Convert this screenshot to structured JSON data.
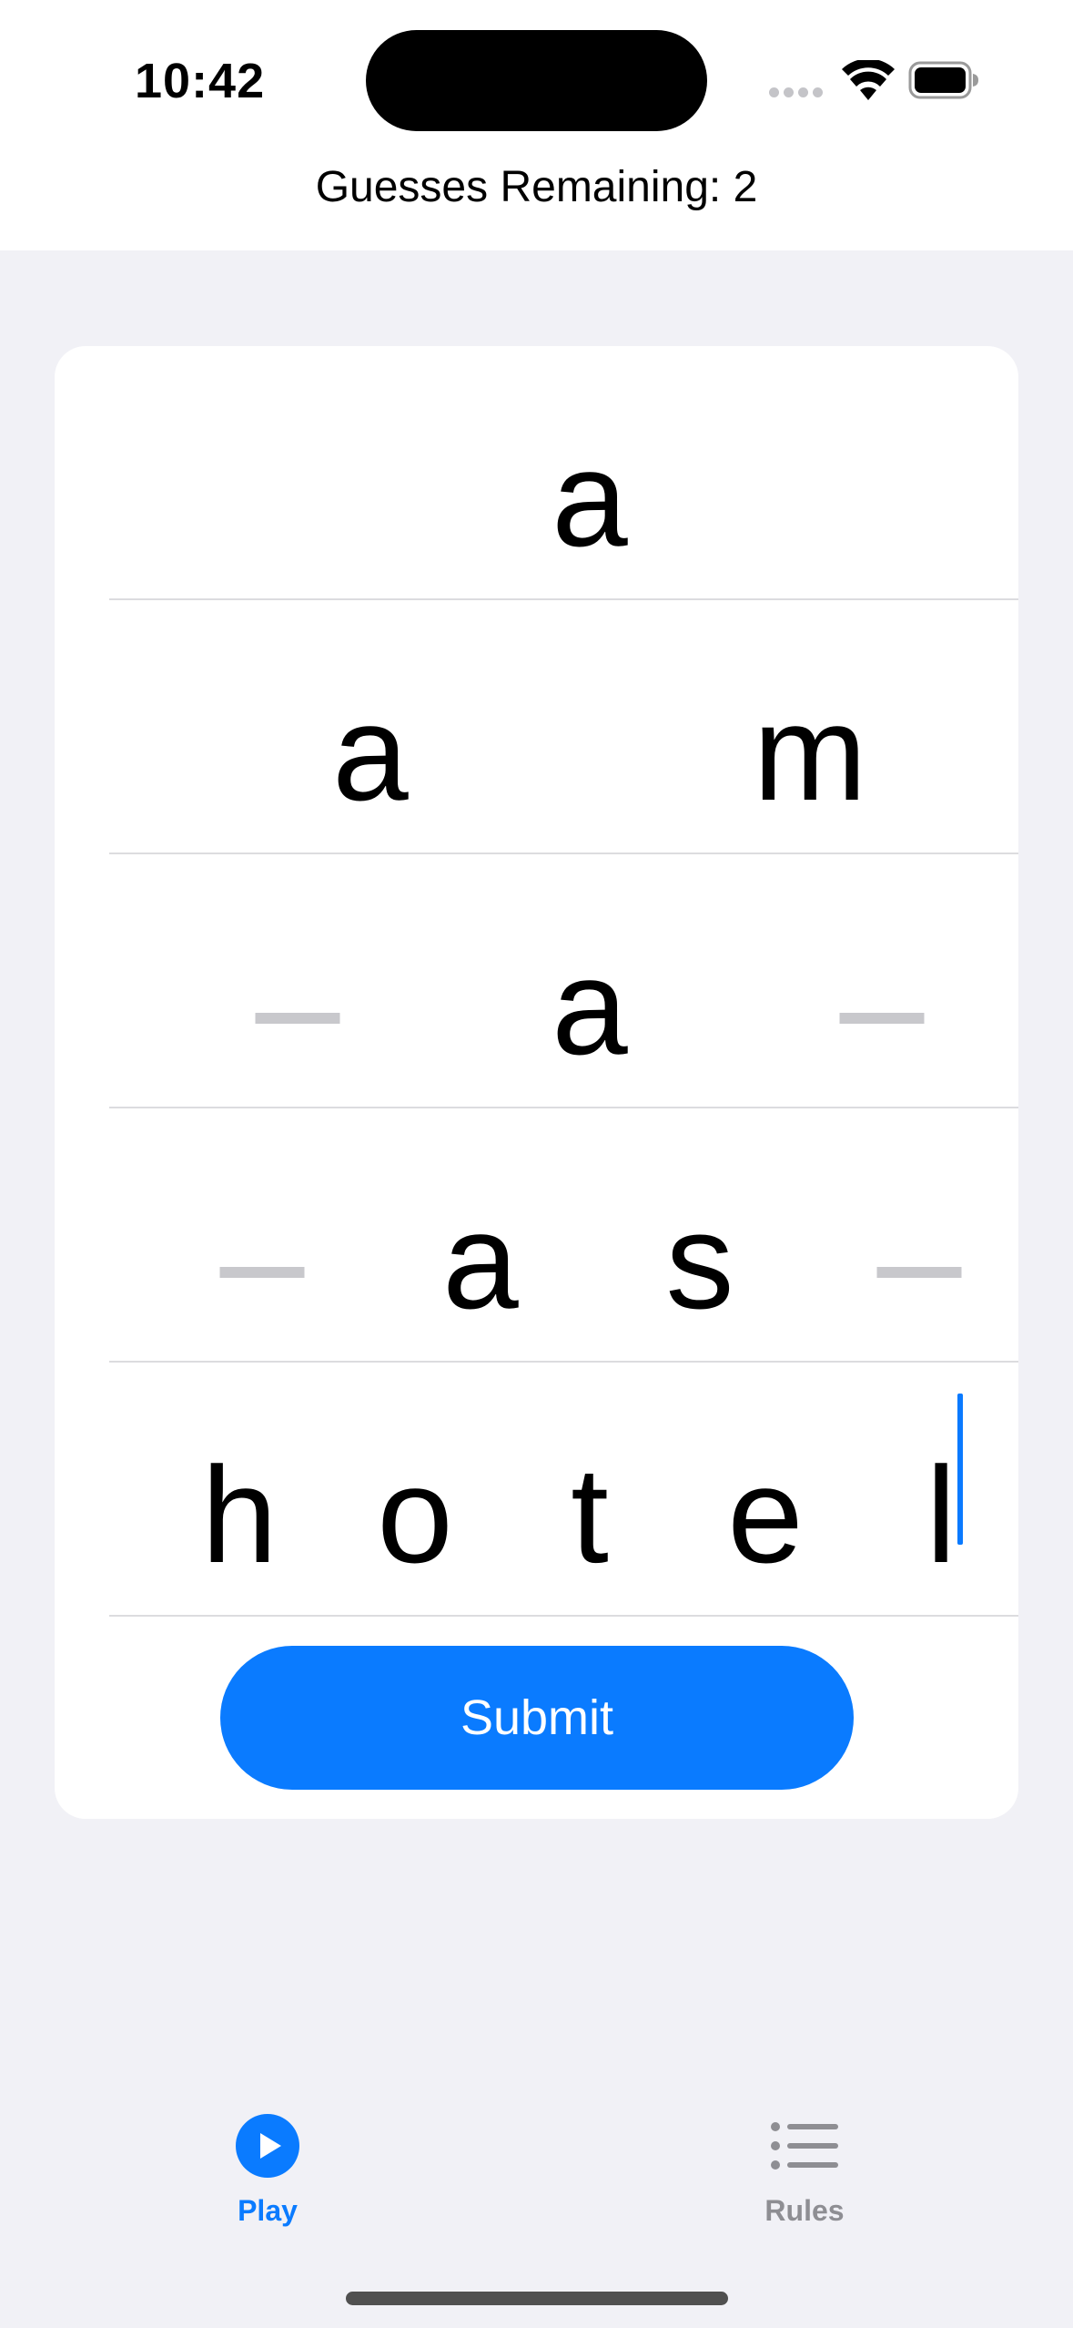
{
  "status_bar": {
    "time": "10:42"
  },
  "header": {
    "guesses_text": "Guesses Remaining: 2"
  },
  "rows": [
    {
      "letters": [
        "a"
      ]
    },
    {
      "letters": [
        "a",
        "m"
      ]
    },
    {
      "letters": [
        "_",
        "a",
        "_"
      ]
    },
    {
      "letters": [
        "_",
        "a",
        "s",
        "_"
      ]
    },
    {
      "letters": [
        "h",
        "o",
        "t",
        "e",
        "l"
      ]
    }
  ],
  "submit": {
    "label": "Submit"
  },
  "tabs": [
    {
      "label": "Play",
      "icon": "play-circle-icon",
      "selected": true
    },
    {
      "label": "Rules",
      "icon": "list-bullet-icon",
      "selected": false
    }
  ],
  "colors": {
    "accent": "#0a7bff",
    "background": "#f1f1f6",
    "inactive": "#8e8e93"
  }
}
